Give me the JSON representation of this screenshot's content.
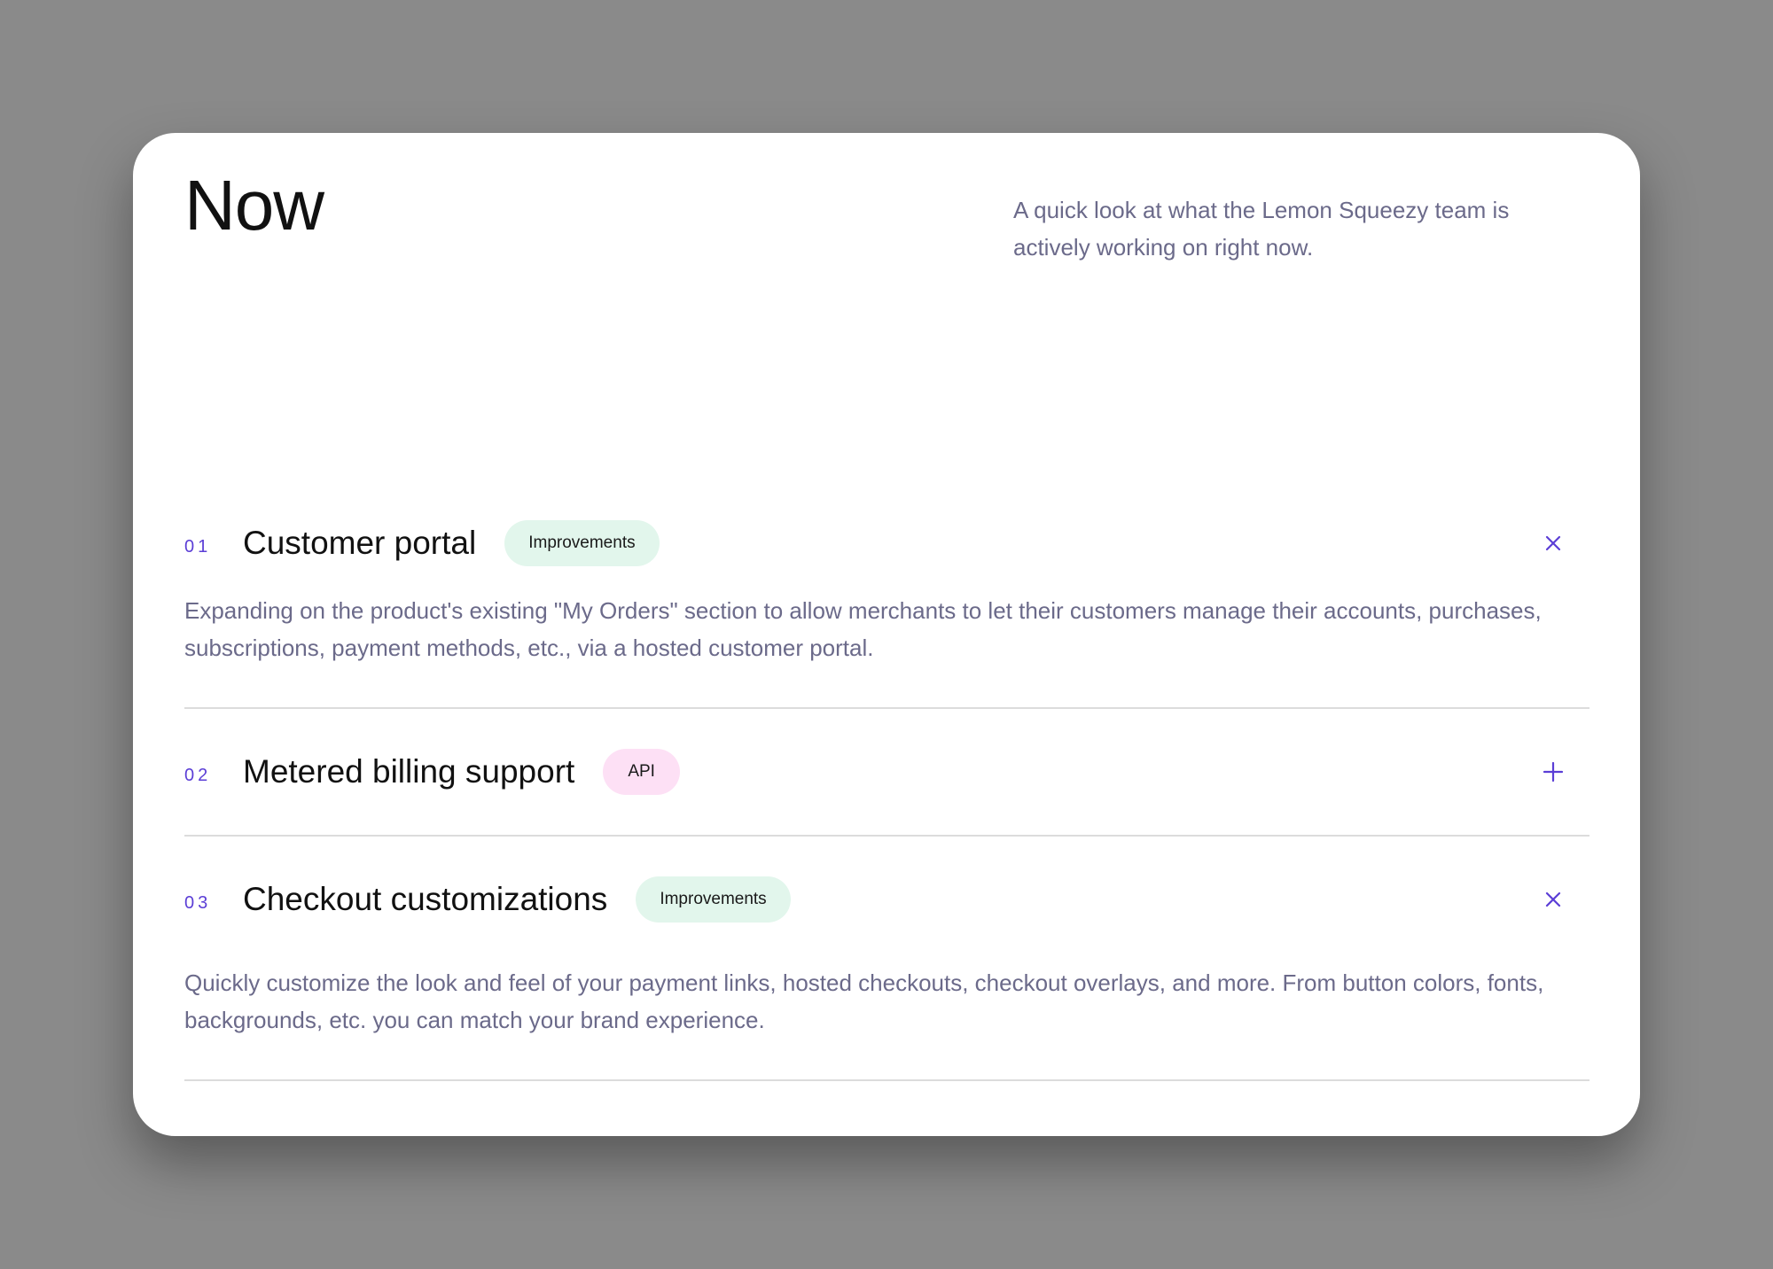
{
  "header": {
    "title": "Now",
    "intro": "A quick look at what the Lemon Squeezy team is actively working on right now."
  },
  "items": [
    {
      "number": "01",
      "title": "Customer portal",
      "tag": "Improvements",
      "expanded": true,
      "toggle_icon": "close-icon",
      "description": "Expanding on the product's existing \"My Orders\" section to allow merchants to let their customers manage their accounts, purchases, subscriptions, payment methods, etc., via a hosted customer portal."
    },
    {
      "number": "02",
      "title": "Metered billing support",
      "tag": "API",
      "expanded": false,
      "toggle_icon": "plus-icon"
    },
    {
      "number": "03",
      "title": "Checkout customizations",
      "tag": "Improvements",
      "expanded": true,
      "toggle_icon": "close-icon",
      "description": "Quickly customize the look and feel of your payment links, hosted checkouts, checkout overlays, and more. From button colors, fonts, backgrounds, etc. you can match your brand experience."
    }
  ],
  "colors": {
    "accent": "#5b3ed6",
    "text": "#111111",
    "muted": "#6b6a8a",
    "tag_improvements_bg": "#e2f6ec",
    "tag_api_bg": "#fde0f5",
    "backdrop": "#8a8a8a"
  }
}
